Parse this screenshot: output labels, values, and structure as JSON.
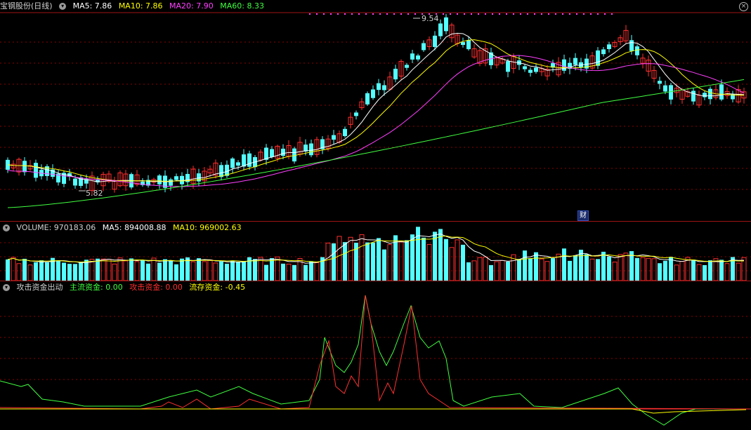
{
  "main_panel": {
    "stock_name": "宝钢股份(日线)",
    "indicators": [
      {
        "label": "MA5: 7.86",
        "color": "#ffffff"
      },
      {
        "label": "MA10: 7.86",
        "color": "#ffff00"
      },
      {
        "label": "MA20: 7.90",
        "color": "#ff40ff"
      },
      {
        "label": "MA60: 8.33",
        "color": "#40ff40"
      }
    ],
    "high_label": "9.54",
    "low_label": "5.82",
    "finance_marker": "财",
    "close_icon": "close-icon"
  },
  "volume_panel": {
    "title": "VOLUME: 970183.06",
    "ma5": "MA5: 894008.88",
    "ma10": "MA10: 969002.63"
  },
  "fund_panel": {
    "title": "攻击资金出动",
    "main_fund": "主流资金: 0.00",
    "attack_fund": "攻击资金: 0.00",
    "stock_fund": "流存资金: -0.45"
  },
  "colors": {
    "up": "#ff3030",
    "down": "#54ffff",
    "ma5": "#ffffff",
    "ma10": "#ffff00",
    "ma20": "#ff40ff",
    "ma60": "#40ff40",
    "grid": "#8b0000"
  }
}
